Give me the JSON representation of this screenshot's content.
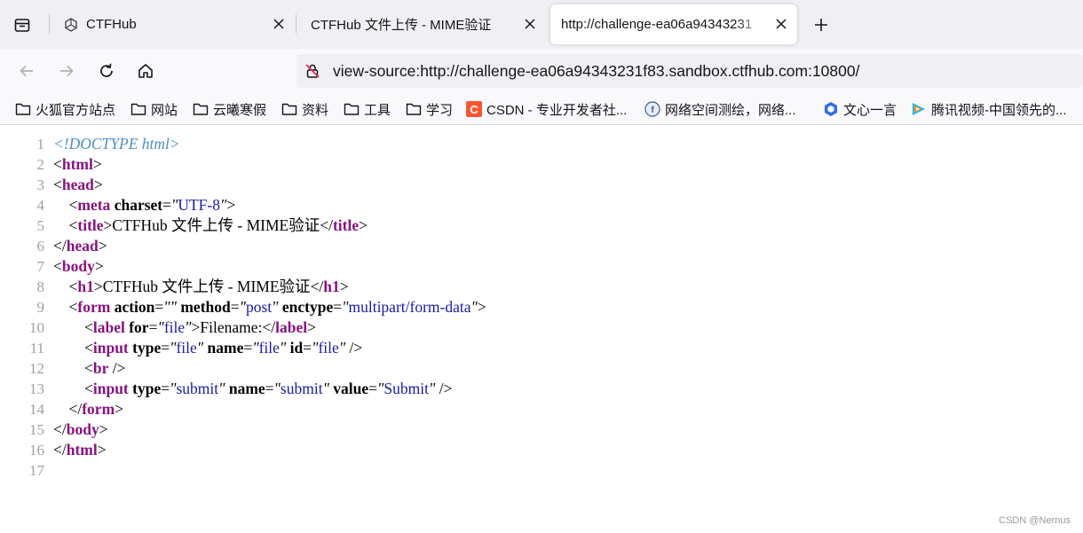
{
  "tabs": [
    {
      "title": "CTFHub",
      "icon": "ctfhub-icon",
      "active": false
    },
    {
      "title": "CTFHub 文件上传 - MIME验证",
      "icon": "",
      "active": false
    },
    {
      "title": "http://challenge-ea06a94343231",
      "icon": "",
      "active": true
    }
  ],
  "navbar": {
    "url": "view-source:http://challenge-ea06a94343231f83.sandbox.ctfhub.com:10800/"
  },
  "bookmarks": [
    {
      "label": "火狐官方站点",
      "icon": "folder-icon"
    },
    {
      "label": "网站",
      "icon": "folder-icon"
    },
    {
      "label": "云曦寒假",
      "icon": "folder-icon"
    },
    {
      "label": "资料",
      "icon": "folder-icon"
    },
    {
      "label": "工具",
      "icon": "folder-icon"
    },
    {
      "label": "学习",
      "icon": "folder-icon"
    },
    {
      "label": "CSDN - 专业开发者社...",
      "icon": "csdn-icon"
    },
    {
      "label": "网络空间测绘，网络...",
      "icon": "fofa-icon"
    },
    {
      "label": "文心一言",
      "icon": "wenxin-icon"
    },
    {
      "label": "腾讯视频-中国领先的...",
      "icon": "tencent-video-icon"
    }
  ],
  "source": {
    "line_numbers": [
      "1",
      "2",
      "3",
      "4",
      "5",
      "6",
      "7",
      "8",
      "9",
      "10",
      "11",
      "12",
      "13",
      "14",
      "15",
      "16",
      "17"
    ],
    "doctype": "<!DOCTYPE html>",
    "tag_html": "html",
    "tag_head": "head",
    "tag_meta": "meta",
    "attr_charset": "charset",
    "val_charset": "UTF-8",
    "tag_title": "title",
    "title_text": "CTFHub 文件上传 - MIME验证",
    "tag_body": "body",
    "tag_h1": "h1",
    "h1_text": "CTFHub 文件上传 - MIME验证",
    "tag_form": "form",
    "attr_action": "action",
    "attr_method": "method",
    "val_method": "post",
    "attr_enctype": "enctype",
    "val_enctype": "multipart/form-data",
    "tag_label": "label",
    "attr_for": "for",
    "val_for": "file",
    "label_text": "Filename:",
    "tag_input": "input",
    "attr_type": "type",
    "val_type_file": "file",
    "attr_name": "name",
    "val_name_file": "file",
    "attr_id": "id",
    "val_id_file": "file",
    "tag_br": "br",
    "val_type_submit": "submit",
    "val_name_submit": "submit",
    "attr_value": "value",
    "val_value_submit": "Submit"
  },
  "watermark": "CSDN @Nernus",
  "colors": {
    "tag": "#881280",
    "attr_value": "#1a1aa6",
    "doctype": "#4b8fc2",
    "line_number": "#a0a0a0"
  }
}
